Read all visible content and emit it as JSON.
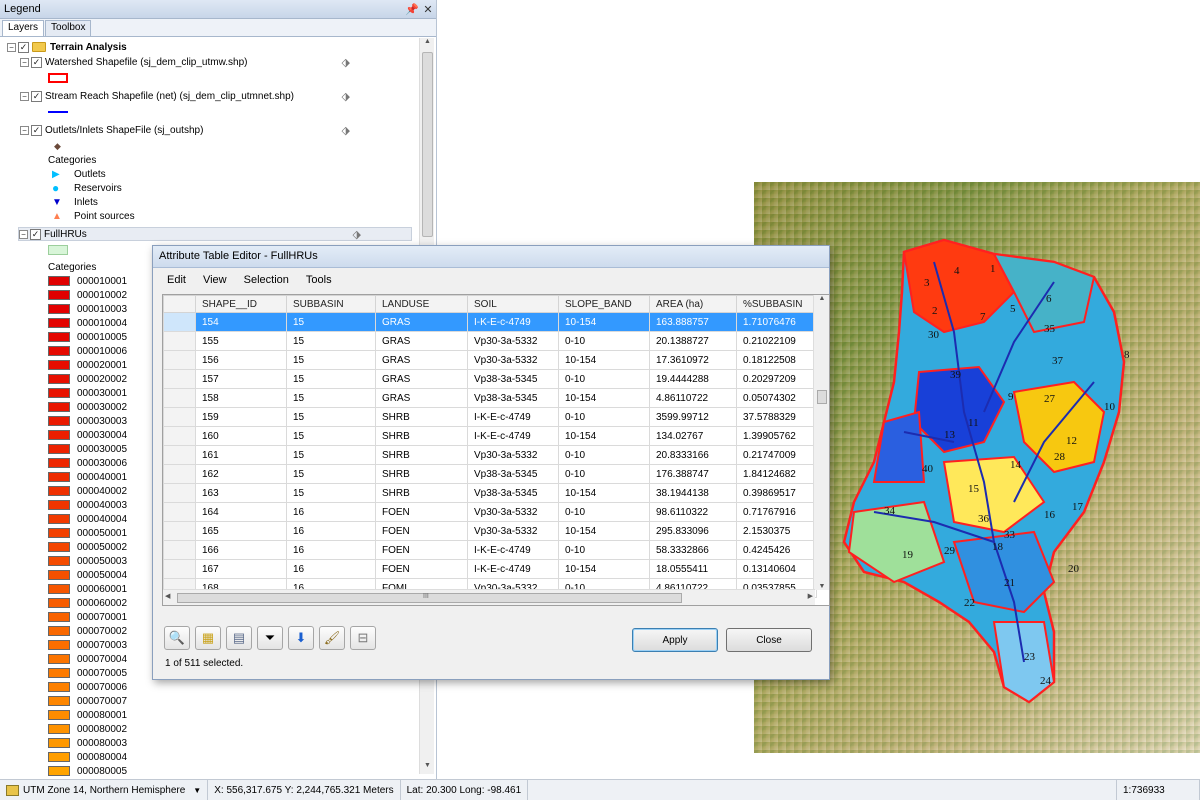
{
  "legend": {
    "title": "Legend",
    "pin": "ᵩ",
    "close": "✕",
    "tabs": [
      "Layers",
      "Toolbox"
    ],
    "group_name": "Terrain Analysis",
    "layers": [
      {
        "name": "Watershed Shapefile (sj_dem_clip_utmw.shp)",
        "swatch": "#ff0000"
      },
      {
        "name": "Stream Reach Shapefile (net) (sj_dem_clip_utmnet.shp)",
        "swatch": "#0000ff"
      },
      {
        "name": "Outlets/Inlets ShapeFile (sj_outshp)",
        "swatch": "#8b4513"
      }
    ],
    "outlet_categories_label": "Categories",
    "outlet_categories": [
      {
        "label": "Outlets",
        "color": "#00bfff",
        "icon": "triangle-right-icon"
      },
      {
        "label": "Reservoirs",
        "color": "#00bfff",
        "icon": "circle-icon"
      },
      {
        "label": "Inlets",
        "color": "#0000cc",
        "icon": "triangle-down-icon"
      },
      {
        "label": "Point sources",
        "color": "#ff7f50",
        "icon": "triangle-up-icon"
      }
    ],
    "hru_layer": "FullHRUs",
    "hru_categories_label": "Categories",
    "hru_categories": [
      {
        "label": "000010001",
        "color": "#e00000"
      },
      {
        "label": "000010002",
        "color": "#e00000"
      },
      {
        "label": "000010003",
        "color": "#e20000"
      },
      {
        "label": "000010004",
        "color": "#e30300"
      },
      {
        "label": "000010005",
        "color": "#e40600"
      },
      {
        "label": "000010006",
        "color": "#e50900"
      },
      {
        "label": "000020001",
        "color": "#e60c00"
      },
      {
        "label": "000020002",
        "color": "#e70f00"
      },
      {
        "label": "000030001",
        "color": "#e81300"
      },
      {
        "label": "000030002",
        "color": "#e91600"
      },
      {
        "label": "000030003",
        "color": "#ea1a00"
      },
      {
        "label": "000030004",
        "color": "#eb1e00"
      },
      {
        "label": "000030005",
        "color": "#ec2200"
      },
      {
        "label": "000030006",
        "color": "#ed2600"
      },
      {
        "label": "000040001",
        "color": "#ee2b00"
      },
      {
        "label": "000040002",
        "color": "#ef3000"
      },
      {
        "label": "000040003",
        "color": "#f03500"
      },
      {
        "label": "000040004",
        "color": "#f13a00"
      },
      {
        "label": "000050001",
        "color": "#f24000"
      },
      {
        "label": "000050002",
        "color": "#f34500"
      },
      {
        "label": "000050003",
        "color": "#f44b00"
      },
      {
        "label": "000050004",
        "color": "#f55000"
      },
      {
        "label": "000060001",
        "color": "#f65600"
      },
      {
        "label": "000060002",
        "color": "#f75c00"
      },
      {
        "label": "000070001",
        "color": "#f86200"
      },
      {
        "label": "000070002",
        "color": "#f96800"
      },
      {
        "label": "000070003",
        "color": "#fa6e00"
      },
      {
        "label": "000070004",
        "color": "#fb7400"
      },
      {
        "label": "000070005",
        "color": "#fc7a00"
      },
      {
        "label": "000070006",
        "color": "#fc8000"
      },
      {
        "label": "000070007",
        "color": "#fd8600"
      },
      {
        "label": "000080001",
        "color": "#fd8c00"
      },
      {
        "label": "000080002",
        "color": "#fe9200"
      },
      {
        "label": "000080003",
        "color": "#fe9800"
      },
      {
        "label": "000080004",
        "color": "#ff9e00"
      },
      {
        "label": "000080005",
        "color": "#ffa400"
      }
    ]
  },
  "attribute_table": {
    "title": "Attribute Table Editor - FullHRUs",
    "menu": [
      "Edit",
      "View",
      "Selection",
      "Tools"
    ],
    "columns": [
      "SHAPE__ID",
      "SUBBASIN",
      "LANDUSE",
      "SOIL",
      "SLOPE_BAND",
      "AREA (ha)",
      "%SUBBASIN"
    ],
    "rows": [
      [
        "154",
        "15",
        "GRAS",
        "I-K-E-c-4749",
        "10-154",
        "163.888757",
        "1.71076476"
      ],
      [
        "155",
        "15",
        "GRAS",
        "Vp30-3a-5332",
        "0-10",
        "20.1388727",
        "0.21022109"
      ],
      [
        "156",
        "15",
        "GRAS",
        "Vp30-3a-5332",
        "10-154",
        "17.3610972",
        "0.18122508"
      ],
      [
        "157",
        "15",
        "GRAS",
        "Vp38-3a-5345",
        "0-10",
        "19.4444288",
        "0.20297209"
      ],
      [
        "158",
        "15",
        "GRAS",
        "Vp38-3a-5345",
        "10-154",
        "4.86110722",
        "0.05074302"
      ],
      [
        "159",
        "15",
        "SHRB",
        "I-K-E-c-4749",
        "0-10",
        "3599.99712",
        "37.5788329"
      ],
      [
        "160",
        "15",
        "SHRB",
        "I-K-E-c-4749",
        "10-154",
        "134.02767",
        "1.39905762"
      ],
      [
        "161",
        "15",
        "SHRB",
        "Vp30-3a-5332",
        "0-10",
        "20.8333166",
        "0.21747009"
      ],
      [
        "162",
        "15",
        "SHRB",
        "Vp38-3a-5345",
        "0-10",
        "176.388747",
        "1.84124682"
      ],
      [
        "163",
        "15",
        "SHRB",
        "Vp38-3a-5345",
        "10-154",
        "38.1944138",
        "0.39869517"
      ],
      [
        "164",
        "16",
        "FOEN",
        "Vp30-3a-5332",
        "0-10",
        "98.6110322",
        "0.71767916"
      ],
      [
        "165",
        "16",
        "FOEN",
        "Vp30-3a-5332",
        "10-154",
        "295.833096",
        "2.1530375"
      ],
      [
        "166",
        "16",
        "FOEN",
        "I-K-E-c-4749",
        "0-10",
        "58.3332866",
        "0.4245426"
      ],
      [
        "167",
        "16",
        "FOEN",
        "I-K-E-c-4749",
        "10-154",
        "18.0555411",
        "0.13140604"
      ],
      [
        "168",
        "16",
        "FOMI",
        "Vp30-3a-5332",
        "0-10",
        "4.86110722",
        "0.03537855"
      ]
    ],
    "selected_row": 0,
    "scroll_marker": "III",
    "toolbar_icons": [
      "zoom-to-icon",
      "select-icon",
      "save-icon",
      "filter-icon",
      "sort-down-icon",
      "paint-brush-icon",
      "clear-icon"
    ],
    "apply_label": "Apply",
    "close_label": "Close",
    "selection_status": "1 of 511 selected."
  },
  "map": {
    "subbasin_labels": [
      "1",
      "2",
      "3",
      "4",
      "5",
      "6",
      "7",
      "8",
      "9",
      "10",
      "11",
      "12",
      "13",
      "14",
      "15",
      "16",
      "17",
      "18",
      "19",
      "20",
      "21",
      "22",
      "23",
      "24",
      "27",
      "28",
      "29",
      "30",
      "33",
      "34",
      "35",
      "36",
      "37",
      "39",
      "40"
    ]
  },
  "statusbar": {
    "projection": "UTM Zone 14, Northern Hemisphere",
    "coords": "X: 556,317.675  Y: 2,244,765.321 Meters",
    "latlong": "Lat: 20.300  Long: -98.461",
    "scale": "1:736933"
  }
}
